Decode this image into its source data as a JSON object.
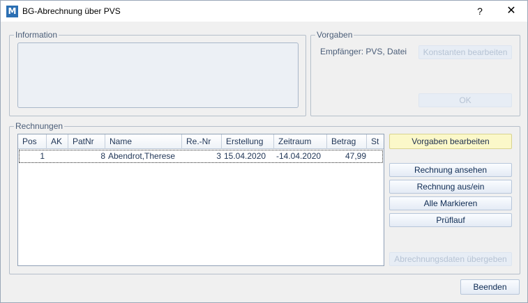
{
  "window": {
    "icon_letter": "M",
    "title": "BG-Abrechnung über PVS",
    "help_label": "?",
    "close_label": "✕"
  },
  "information": {
    "legend": "Information"
  },
  "vorgaben": {
    "legend": "Vorgaben",
    "empfaenger_text": "Empfänger: PVS, Datei",
    "konstanten_label": "Konstanten bearbeiten",
    "ok_label": "OK"
  },
  "rechnungen": {
    "legend": "Rechnungen",
    "columns": [
      "Pos",
      "AK",
      "PatNr",
      "Name",
      "Re.-Nr",
      "Erstellung",
      "Zeitraum",
      "Betrag",
      "St"
    ],
    "rows": [
      {
        "pos": "1",
        "ak": "",
        "patnr": "8",
        "name": "Abendrot,Therese",
        "renr": "3",
        "erstellung": "15.04.2020",
        "zeitraum": "-14.04.2020",
        "betrag": "47,99",
        "st": ""
      }
    ]
  },
  "actions": {
    "vorgaben_bearbeiten": "Vorgaben bearbeiten",
    "rechnung_ansehen": "Rechnung ansehen",
    "rechnung_aus_ein": "Rechnung aus/ein",
    "alle_markieren": "Alle Markieren",
    "prueflauf": "Prüflauf",
    "abrechnungsdaten": "Abrechnungsdaten übergeben",
    "beenden": "Beenden"
  },
  "colors": {
    "accent_icon": "#2b6fb3",
    "highlight_button": "#fbf8c9",
    "text": "#1f3556"
  }
}
